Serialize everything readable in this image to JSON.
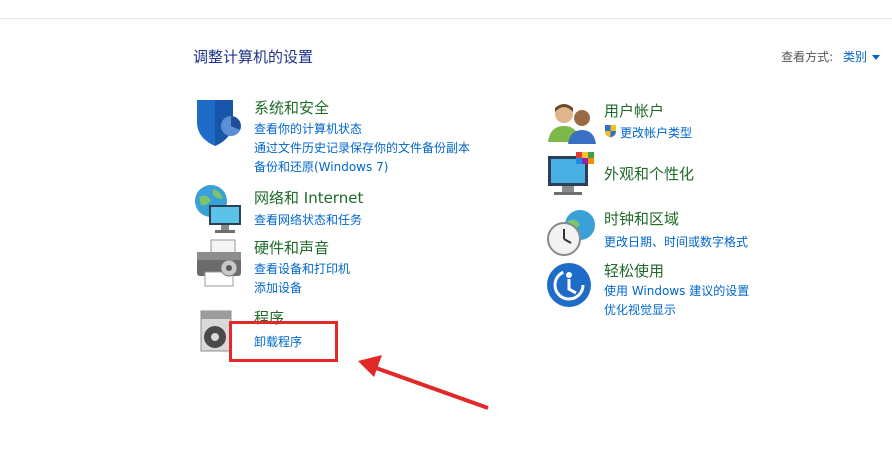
{
  "header": {
    "title": "调整计算机的设置"
  },
  "view_by": {
    "label": "查看方式:",
    "value": "类别"
  },
  "left_categories": [
    {
      "title": "系统和安全",
      "links": [
        "查看你的计算机状态",
        "通过文件历史记录保存你的文件备份副本",
        "备份和还原(Windows 7)"
      ]
    },
    {
      "title": "网络和 Internet",
      "links": [
        "查看网络状态和任务"
      ]
    },
    {
      "title": "硬件和声音",
      "links": [
        "查看设备和打印机",
        "添加设备"
      ]
    },
    {
      "title": "程序",
      "links": [
        "卸载程序"
      ]
    }
  ],
  "right_categories": [
    {
      "title": "用户帐户",
      "links": [
        "更改帐户类型"
      ]
    },
    {
      "title": "外观和个性化",
      "links": []
    },
    {
      "title": "时钟和区域",
      "links": [
        "更改日期、时间或数字格式"
      ]
    },
    {
      "title": "轻松使用",
      "links": [
        "使用 Windows 建议的设置",
        "优化视觉显示"
      ]
    }
  ],
  "colors": {
    "category_title": "#1e6b28",
    "link": "#0066cc",
    "annotation": "#e22828"
  }
}
